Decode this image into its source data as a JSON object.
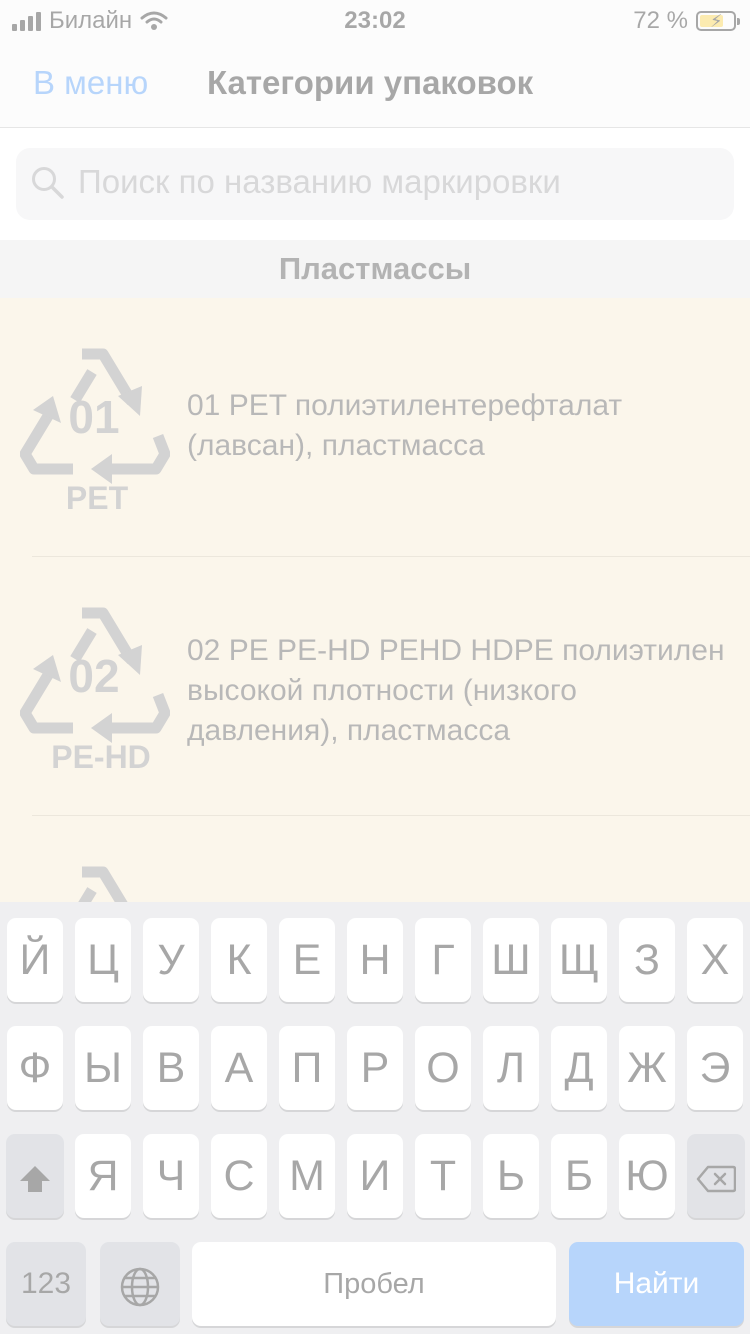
{
  "status_bar": {
    "carrier": "Билайн",
    "time": "23:02",
    "battery_percent": "72 %",
    "battery_level": 0.72,
    "battery_color": "#f7c61b"
  },
  "nav": {
    "back_label": "В меню",
    "title": "Категории упаковок"
  },
  "search": {
    "placeholder": "Поиск по названию маркировки"
  },
  "section": {
    "title": "Пластмассы"
  },
  "items": [
    {
      "code": "01",
      "abbr": "PET",
      "text": "01 PET полиэтилентерефталат (лавсан), пластмасса",
      "icon": "recycle-01-pet-icon"
    },
    {
      "code": "02",
      "abbr": "PE-HD",
      "text": "02 PE PE-HD PEHD HDPE полиэтилен высокой плотности (низкого давления), пластмасса",
      "icon": "recycle-02-pe-hd-icon"
    }
  ],
  "keyboard": {
    "row1": [
      "Й",
      "Ц",
      "У",
      "К",
      "Е",
      "Н",
      "Г",
      "Ш",
      "Щ",
      "З",
      "Х"
    ],
    "row2": [
      "Ф",
      "Ы",
      "В",
      "А",
      "П",
      "Р",
      "О",
      "Л",
      "Д",
      "Ж",
      "Э"
    ],
    "row3": [
      "Я",
      "Ч",
      "С",
      "М",
      "И",
      "Т",
      "Ь",
      "Б",
      "Ю"
    ],
    "numbers_label": "123",
    "space_label": "Пробел",
    "search_label": "Найти"
  },
  "colors": {
    "accent": "#2f86f6",
    "list_background": "#f6e6c7",
    "icon_gray": "#7f7f7f"
  }
}
